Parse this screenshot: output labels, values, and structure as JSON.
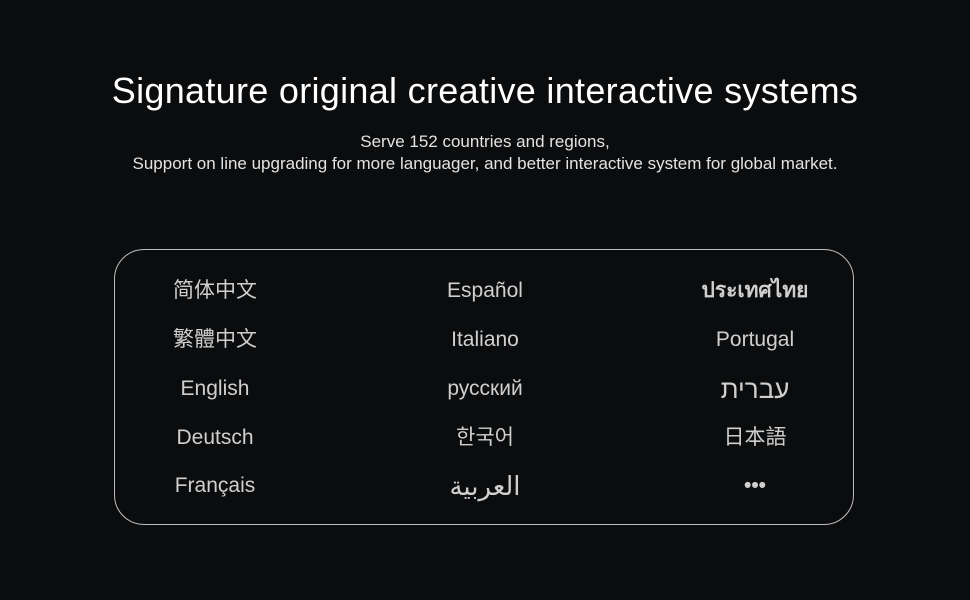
{
  "headline": "Signature original creative interactive systems",
  "subtitle_line1": "Serve 152 countries and regions,",
  "subtitle_line2": "Support on line upgrading for more languager, and better interactive system for global market.",
  "languages": {
    "col1": [
      "简体中文",
      "繁體中文",
      "English",
      "Deutsch",
      "Français"
    ],
    "col2": [
      "Español",
      "Italiano",
      "русский",
      "한국어",
      "العربية"
    ],
    "col3": [
      "ประเทศไทย",
      "Portugal",
      "עברית",
      "日本語",
      "•••"
    ]
  }
}
